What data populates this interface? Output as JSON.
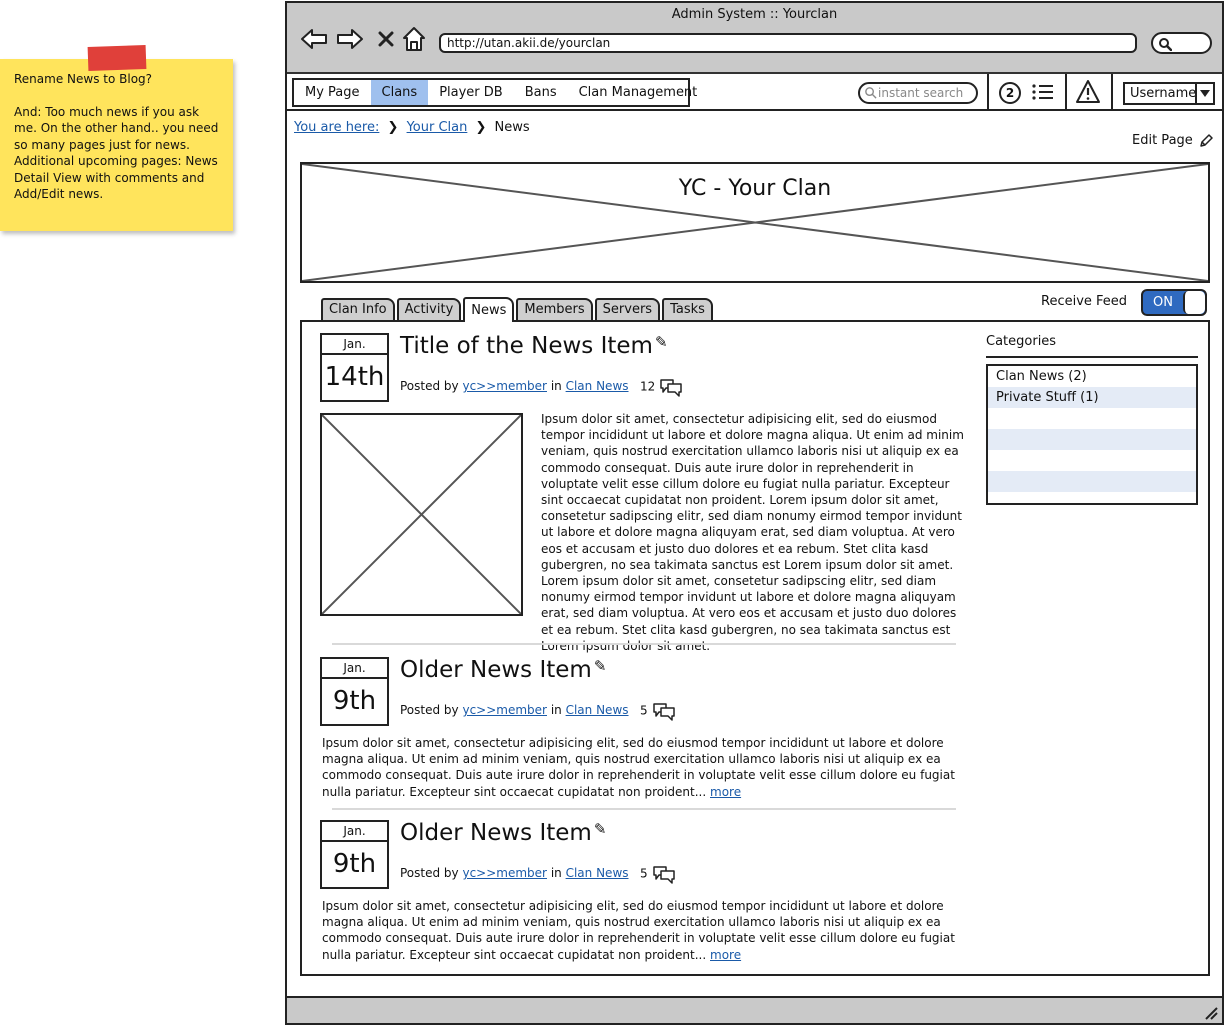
{
  "sticky_note": {
    "title": "Rename News to Blog?",
    "text": "And: Too much news if you ask me. On the other hand.. you need so many pages just for news. Additional upcoming pages: News Detail View with comments and Add/Edit news."
  },
  "browser": {
    "title": "Admin System :: Yourclan",
    "url": "http://utan.akii.de/yourclan"
  },
  "nav": {
    "menu": [
      "My Page",
      "Clans",
      "Player DB",
      "Bans",
      "Clan Management"
    ],
    "active": "Clans",
    "search_placeholder": "instant search",
    "notification_count": "2",
    "username": "Username"
  },
  "breadcrumb": {
    "prefix": "You are here:",
    "items": [
      "Your Clan",
      "News"
    ]
  },
  "edit_page_label": "Edit Page",
  "clan_title": "YC - Your Clan",
  "tabs": [
    "Clan Info",
    "Activity",
    "News",
    "Members",
    "Servers",
    "Tasks"
  ],
  "active_tab": "News",
  "receive_feed": {
    "label": "Receive Feed",
    "state": "ON"
  },
  "posted_by_label": "Posted by",
  "in_label": "in",
  "more_label": "more",
  "news": [
    {
      "month": "Jan.",
      "day": "14th",
      "title": "Title of the News Item",
      "author": "yc>>member",
      "category": "Clan News",
      "comments": "12",
      "body": "Ipsum dolor sit amet, consectetur adipisicing elit, sed do eiusmod tempor incididunt ut labore et dolore magna aliqua. Ut enim ad minim veniam, quis nostrud exercitation ullamco laboris nisi ut aliquip ex ea commodo consequat. Duis aute irure dolor in reprehenderit in voluptate velit esse cillum dolore eu fugiat nulla pariatur. Excepteur sint occaecat cupidatat non proident. Lorem ipsum dolor sit amet, consetetur sadipscing elitr, sed diam nonumy eirmod tempor invidunt ut labore et dolore magna aliquyam erat, sed diam voluptua. At vero eos et accusam et justo duo dolores et ea rebum. Stet clita kasd gubergren, no sea takimata sanctus est Lorem ipsum dolor sit amet. Lorem ipsum dolor sit amet, consetetur sadipscing elitr, sed diam nonumy eirmod tempor invidunt ut labore et dolore magna aliquyam erat, sed diam voluptua. At vero eos et accusam et justo duo dolores et ea rebum. Stet clita kasd gubergren, no sea takimata sanctus est Lorem ipsum dolor sit amet."
    },
    {
      "month": "Jan.",
      "day": "9th",
      "title": "Older News Item",
      "author": "yc>>member",
      "category": "Clan News",
      "comments": "5",
      "body": "Ipsum dolor sit amet, consectetur adipisicing elit, sed do eiusmod tempor incididunt ut labore et dolore magna aliqua. Ut enim ad minim veniam, quis nostrud exercitation ullamco laboris nisi ut aliquip ex ea commodo consequat. Duis aute irure dolor in reprehenderit in voluptate velit esse cillum dolore eu fugiat nulla pariatur. Excepteur sint occaecat cupidatat non proident..."
    },
    {
      "month": "Jan.",
      "day": "9th",
      "title": "Older News Item",
      "author": "yc>>member",
      "category": "Clan News",
      "comments": "5",
      "body": "Ipsum dolor sit amet, consectetur adipisicing elit, sed do eiusmod tempor incididunt ut labore et dolore magna aliqua. Ut enim ad minim veniam, quis nostrud exercitation ullamco laboris nisi ut aliquip ex ea commodo consequat. Duis aute irure dolor in reprehenderit in voluptate velit esse cillum dolore eu fugiat nulla pariatur. Excepteur sint occaecat cupidatat non proident..."
    }
  ],
  "categories": {
    "title": "Categories",
    "items": [
      "Clan News (2)",
      "Private Stuff (1)"
    ]
  },
  "colors": {
    "sticky": "#ffe45c",
    "tape": "#e0403a",
    "active_menu": "#9fc0ee",
    "toggle_on": "#2f6ac0",
    "link": "#1a5aa8",
    "chrome": "#c9c9c9",
    "category_alt_row": "#e4ebf6"
  }
}
